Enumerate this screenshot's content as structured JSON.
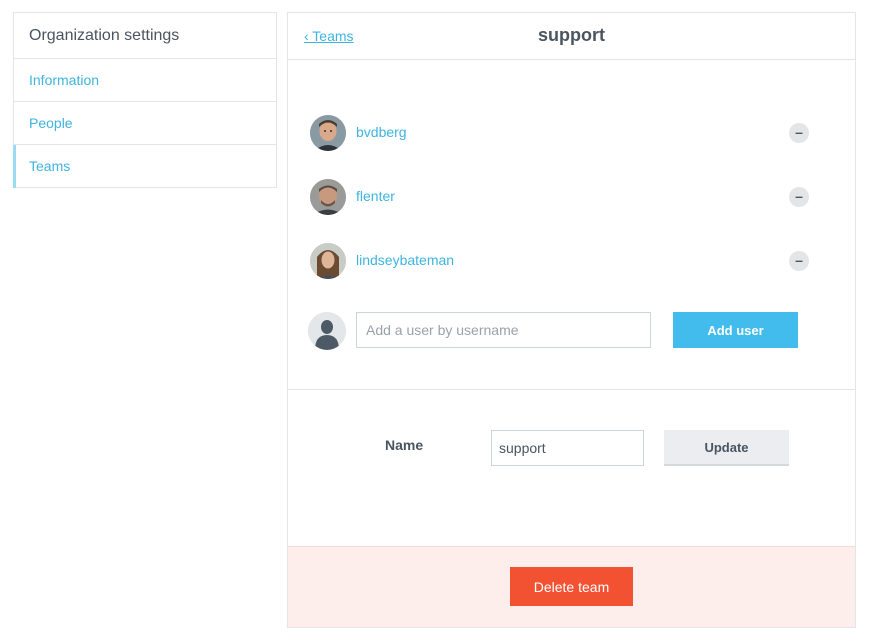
{
  "sidebar": {
    "title": "Organization settings",
    "items": [
      {
        "label": "Information"
      },
      {
        "label": "People"
      },
      {
        "label": "Teams"
      }
    ]
  },
  "header": {
    "back_label": "‹ Teams",
    "title": "support"
  },
  "members": [
    {
      "username": "bvdberg",
      "remove_label": "–"
    },
    {
      "username": "flenter",
      "remove_label": "–"
    },
    {
      "username": "lindseybateman",
      "remove_label": "–"
    }
  ],
  "add_user": {
    "placeholder": "Add a user by username",
    "value": "",
    "button_label": "Add user"
  },
  "team_name": {
    "label": "Name",
    "value": "support",
    "button_label": "Update"
  },
  "danger": {
    "delete_label": "Delete team"
  },
  "colors": {
    "accent": "#3eb4df",
    "primary_button": "#42bced",
    "danger_button": "#f25232",
    "danger_bg": "#fdeeec"
  }
}
